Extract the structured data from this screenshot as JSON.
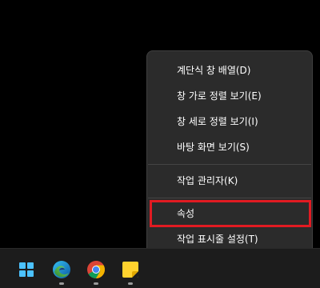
{
  "context_menu": {
    "items": [
      {
        "label": "계단식 창 배열(D)"
      },
      {
        "label": "창 가로 정렬 보기(E)"
      },
      {
        "label": "창 세로 정렬 보기(I)"
      },
      {
        "label": "바탕 화면 보기(S)"
      },
      {
        "label": "작업 관리자(K)"
      },
      {
        "label": "속성"
      },
      {
        "label": "작업 표시줄 설정(T)"
      }
    ]
  },
  "taskbar": {
    "apps": [
      {
        "icon": "windows-start-icon"
      },
      {
        "icon": "edge-icon"
      },
      {
        "icon": "chrome-icon"
      },
      {
        "icon": "sticky-notes-icon"
      }
    ]
  },
  "colors": {
    "menu_bg": "#2b2b2b",
    "highlight": "#e11b22",
    "taskbar_bg": "#1c1c1c",
    "start_blue": "#4cc2ff"
  }
}
